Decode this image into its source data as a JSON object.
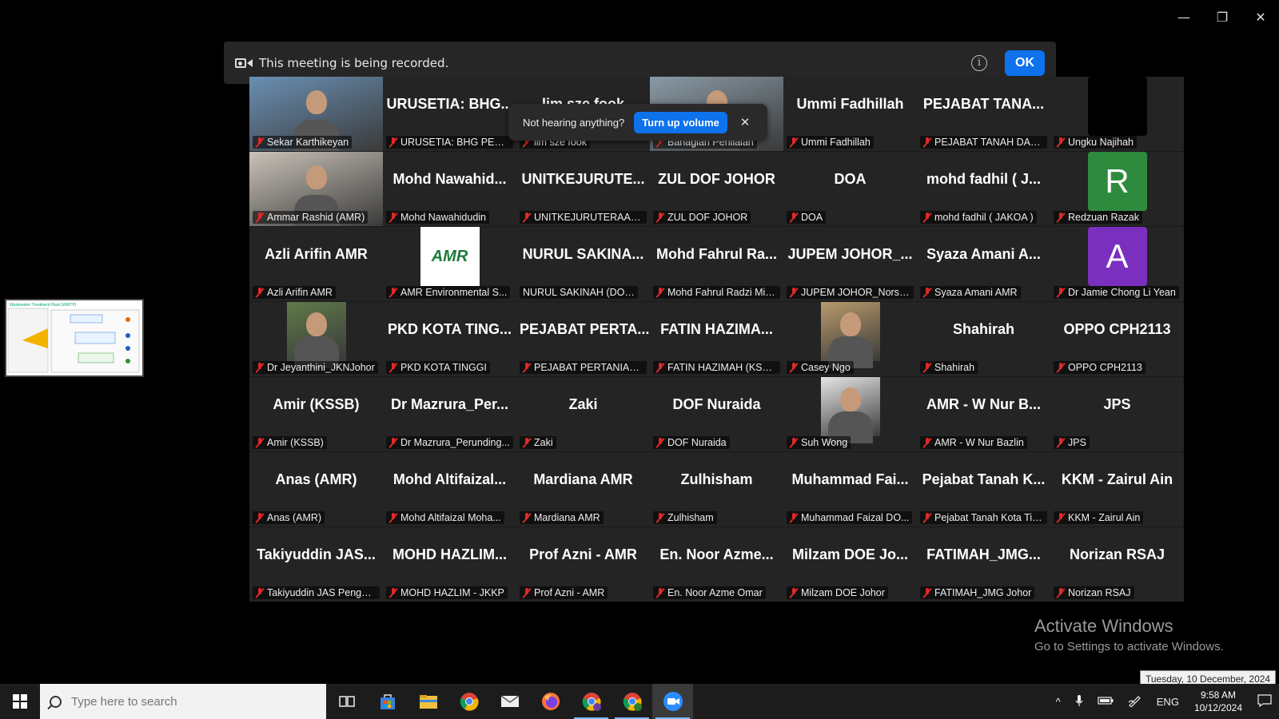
{
  "window": {
    "minimize": "—",
    "restore": "❐",
    "close": "✕"
  },
  "recording": {
    "text": "This meeting is being recorded.",
    "info": "i",
    "ok": "OK"
  },
  "hearing_tip": {
    "question": "Not hearing anything?",
    "button": "Turn up volume",
    "close": "✕"
  },
  "share_thumbnail": {
    "title": "Wastewater Treatment Plant (WWTP)"
  },
  "participants": [
    {
      "display": "",
      "name": "Sekar Karthikeyan",
      "kind": "video",
      "color": "#6a8fb3"
    },
    {
      "display": "URUSETIA: BHG...",
      "name": "URUSETIA: BHG PENIL...",
      "kind": "text"
    },
    {
      "display": "lim sze fook",
      "name": "lim sze fook",
      "kind": "text"
    },
    {
      "display": "",
      "name": "Bahagian Penilaian",
      "kind": "video",
      "color": "#8a9aa6",
      "active": true
    },
    {
      "display": "Ummi Fadhillah",
      "name": "Ummi Fadhillah",
      "kind": "text"
    },
    {
      "display": "PEJABAT TANA...",
      "name": "PEJABAT TANAH DAN ...",
      "kind": "text"
    },
    {
      "display": "",
      "name": "Ungku Najihah",
      "kind": "avatar",
      "color": "#000000",
      "letter": ""
    },
    {
      "display": "",
      "name": "Ammar Rashid (AMR)",
      "kind": "video",
      "color": "#c9c2b8"
    },
    {
      "display": "Mohd Nawahid...",
      "name": "Mohd Nawahidudin",
      "kind": "text"
    },
    {
      "display": "UNITKEJURUTE...",
      "name": "UNITKEJURUTERAANJ...",
      "kind": "text"
    },
    {
      "display": "ZUL DOF JOHOR",
      "name": "ZUL DOF JOHOR",
      "kind": "text"
    },
    {
      "display": "DOA",
      "name": "DOA",
      "kind": "text"
    },
    {
      "display": "mohd fadhil ( J...",
      "name": "mohd fadhil ( JAKOA )",
      "kind": "text"
    },
    {
      "display": "",
      "name": "Redzuan Razak",
      "kind": "avatar",
      "color": "#2e8b3e",
      "letter": "R"
    },
    {
      "display": "Azli Arifin AMR",
      "name": "Azli Arifin AMR",
      "kind": "text"
    },
    {
      "display": "",
      "name": "AMR Environmental S...",
      "kind": "logo",
      "logo": "AMR"
    },
    {
      "display": "NURUL SAKINA...",
      "name": "NURUL SAKINAH (DOE-H...",
      "kind": "text",
      "nomic": true
    },
    {
      "display": "Mohd Fahrul Ra...",
      "name": "Mohd Fahrul Radzi Mis...",
      "kind": "text"
    },
    {
      "display": "JUPEM JOHOR_...",
      "name": "JUPEM JOHOR_Norsy...",
      "kind": "text"
    },
    {
      "display": "Syaza Amani A...",
      "name": "Syaza Amani AMR",
      "kind": "text"
    },
    {
      "display": "",
      "name": "Dr Jamie Chong Li Yean",
      "kind": "avatar",
      "color": "#7b2fbe",
      "letter": "A"
    },
    {
      "display": "",
      "name": "Dr Jeyanthini_JKNJohor",
      "kind": "photo",
      "color": "#5f7a4a"
    },
    {
      "display": "PKD KOTA TING...",
      "name": "PKD KOTA TINGGI",
      "kind": "text"
    },
    {
      "display": "PEJABAT PERTA...",
      "name": "PEJABAT PERTANIAN D...",
      "kind": "text"
    },
    {
      "display": "FATIN HAZIMA...",
      "name": "FATIN HAZIMAH (KSSB)",
      "kind": "text"
    },
    {
      "display": "",
      "name": "Casey Ngo",
      "kind": "photo",
      "color": "#b89a6a"
    },
    {
      "display": "Shahirah",
      "name": "Shahirah",
      "kind": "text"
    },
    {
      "display": "OPPO CPH2113",
      "name": "OPPO CPH2113",
      "kind": "text"
    },
    {
      "display": "Amir (KSSB)",
      "name": "Amir (KSSB)",
      "kind": "text"
    },
    {
      "display": "Dr Mazrura_Per...",
      "name": "Dr Mazrura_Perunding...",
      "kind": "text"
    },
    {
      "display": "Zaki",
      "name": "Zaki",
      "kind": "text"
    },
    {
      "display": "DOF Nuraida",
      "name": "DOF Nuraida",
      "kind": "text"
    },
    {
      "display": "",
      "name": "Suh Wong",
      "kind": "photo",
      "color": "#e6e6e6"
    },
    {
      "display": "AMR - W Nur B...",
      "name": "AMR - W Nur Bazlin",
      "kind": "text"
    },
    {
      "display": "JPS",
      "name": "JPS",
      "kind": "text"
    },
    {
      "display": "Anas (AMR)",
      "name": "Anas (AMR)",
      "kind": "text"
    },
    {
      "display": "Mohd Altifaizal...",
      "name": "Mohd Altifaizal Moha...",
      "kind": "text"
    },
    {
      "display": "Mardiana AMR",
      "name": "Mardiana AMR",
      "kind": "text"
    },
    {
      "display": "Zulhisham",
      "name": "Zulhisham",
      "kind": "text"
    },
    {
      "display": "Muhammad Fai...",
      "name": "Muhammad Faizal DO...",
      "kind": "text"
    },
    {
      "display": "Pejabat Tanah K...",
      "name": "Pejabat Tanah Kota Tin...",
      "kind": "text"
    },
    {
      "display": "KKM - Zairul Ain",
      "name": "KKM - Zairul Ain",
      "kind": "text"
    },
    {
      "display": "Takiyuddin JAS...",
      "name": "Takiyuddin JAS Penger...",
      "kind": "text"
    },
    {
      "display": "MOHD HAZLIM...",
      "name": "MOHD HAZLIM - JKKP",
      "kind": "text"
    },
    {
      "display": "Prof Azni - AMR",
      "name": "Prof Azni - AMR",
      "kind": "text"
    },
    {
      "display": "En. Noor Azme...",
      "name": "En. Noor Azme Omar",
      "kind": "text"
    },
    {
      "display": "Milzam DOE Jo...",
      "name": "Milzam DOE Johor",
      "kind": "text"
    },
    {
      "display": "FATIMAH_JMG...",
      "name": "FATIMAH_JMG Johor",
      "kind": "text"
    },
    {
      "display": "Norizan RSAJ",
      "name": "Norizan RSAJ",
      "kind": "text"
    }
  ],
  "watermark": {
    "line1": "Activate Windows",
    "line2": "Go to Settings to activate Windows."
  },
  "date_tooltip": "Tuesday, 10 December, 2024",
  "taskbar": {
    "search_placeholder": "Type here to search",
    "apps": [
      "task-view",
      "microsoft-store",
      "file-explorer",
      "chrome",
      "mail",
      "firefox",
      "chrome-profile-m",
      "chrome-profile-r",
      "zoom"
    ],
    "tray": {
      "chevron": "^",
      "lang": "ENG"
    },
    "time": "9:58 AM",
    "date": "10/12/2024"
  }
}
